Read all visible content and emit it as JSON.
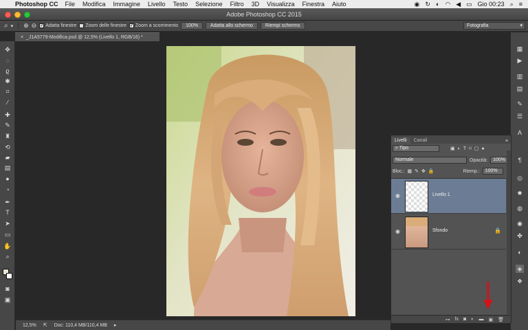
{
  "menubar": {
    "app_name": "Photoshop CC",
    "items": [
      "File",
      "Modifica",
      "Immagine",
      "Livello",
      "Testo",
      "Selezione",
      "Filtro",
      "3D",
      "Visualizza",
      "Finestra",
      "Aiuto"
    ],
    "clock": "Gio 00:23"
  },
  "window": {
    "title": "Adobe Photoshop CC 2015"
  },
  "options": {
    "fit_windows_label": "Adatta finestre",
    "zoom_all_label": "Zoom delle finestre",
    "scrubby_zoom_label": "Zoom a scorrimento",
    "pct_button": "100%",
    "fit_screen_button": "Adatta allo schermo",
    "fill_screen_button": "Riempi schermo",
    "workspace": "Fotografia"
  },
  "document": {
    "tab_title": "_J1A5779-Modifica.psd @ 12,5% (Livello 1, RGB/16) *"
  },
  "status": {
    "zoom": "12,5%",
    "doc_info": "Doc: 110,4 MB/110,4 MB"
  },
  "layers_panel": {
    "tabs": [
      "Livelli",
      "Canali"
    ],
    "filter_kind": "Tipo",
    "blend_mode": "Normale",
    "opacity_label": "Opacità:",
    "opacity_value": "100%",
    "lock_label": "Bloc.:",
    "fill_label": "Riemp.:",
    "fill_value": "100%",
    "layers": [
      {
        "name": "Livello 1",
        "selected": true
      },
      {
        "name": "Sfondo",
        "selected": false
      }
    ]
  },
  "colors": {
    "accent_selected": "#6b7c94",
    "arrow": "#d0141a"
  }
}
